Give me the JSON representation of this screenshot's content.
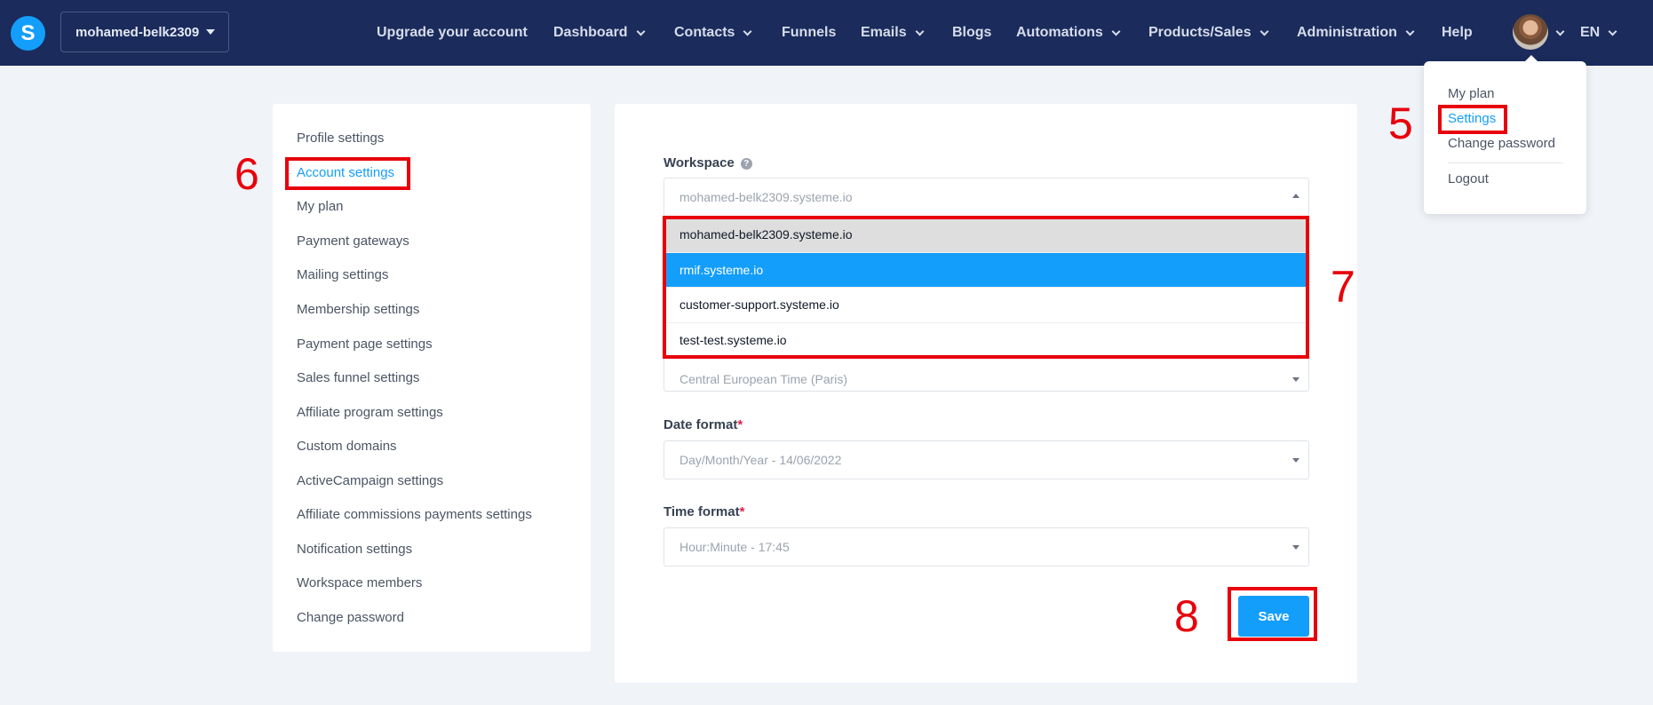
{
  "app": {
    "logo_letter": "S"
  },
  "workspace_switcher": {
    "label": "mohamed-belk2309"
  },
  "nav": {
    "items": [
      {
        "label": "Upgrade your account",
        "has_chevron": false
      },
      {
        "label": "Dashboard",
        "has_chevron": true
      },
      {
        "label": "Contacts",
        "has_chevron": true
      },
      {
        "label": "Funnels",
        "has_chevron": false
      },
      {
        "label": "Emails",
        "has_chevron": true
      },
      {
        "label": "Blogs",
        "has_chevron": false
      },
      {
        "label": "Automations",
        "has_chevron": true
      },
      {
        "label": "Products/Sales",
        "has_chevron": true
      },
      {
        "label": "Administration",
        "has_chevron": true
      },
      {
        "label": "Help",
        "has_chevron": false
      }
    ],
    "language": "EN"
  },
  "profile_menu": {
    "items": [
      "My plan",
      "Settings",
      "Change password",
      "Logout"
    ],
    "active": "Settings"
  },
  "sidebar": {
    "items": [
      "Profile settings",
      "Account settings",
      "My plan",
      "Payment gateways",
      "Mailing settings",
      "Membership settings",
      "Payment page settings",
      "Sales funnel settings",
      "Affiliate program settings",
      "Custom domains",
      "ActiveCampaign settings",
      "Affiliate commissions payments settings",
      "Notification settings",
      "Workspace members",
      "Change password"
    ],
    "active": "Account settings"
  },
  "form": {
    "workspace": {
      "label": "Workspace",
      "value": "mohamed-belk2309.systeme.io",
      "options": [
        "mohamed-belk2309.systeme.io",
        "rmif.systeme.io",
        "customer-support.systeme.io",
        "test-test.systeme.io"
      ],
      "hovered_option": "mohamed-belk2309.systeme.io",
      "selected_option": "rmif.systeme.io"
    },
    "timezone": {
      "value": "Central European Time (Paris)"
    },
    "date_format": {
      "label": "Date format",
      "required_mark": "*",
      "value": "Day/Month/Year - 14/06/2022"
    },
    "time_format": {
      "label": "Time format",
      "required_mark": "*",
      "value": "Hour:Minute - 17:45"
    },
    "save_label": "Save"
  },
  "annotations": {
    "step_5": "5",
    "step_6": "6",
    "step_7": "7",
    "step_8": "8"
  },
  "colors": {
    "nav_bg": "#1a2b5c",
    "accent": "#149efc",
    "annotation_red": "#e8000b",
    "page_bg": "#f0f3f8"
  }
}
